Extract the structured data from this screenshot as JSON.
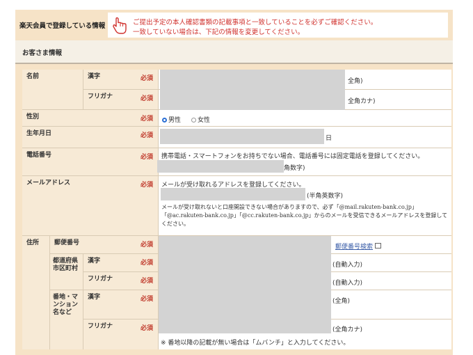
{
  "header": {
    "title": "楽天会員で登録している情報",
    "notice_line1": "ご提出予定の本人確認書類の記載事項と一致していることを必ずご確認ください。",
    "notice_line2": "一致していない場合は、下記の情報を変更してください。"
  },
  "section_title": "お客さま情報",
  "required_label": "必須",
  "fields": {
    "name": {
      "label": "名前",
      "kanji": "漢字",
      "furigana": "フリガナ",
      "kanji_hint": "全角)",
      "furigana_hint": "全角カナ)"
    },
    "gender": {
      "label": "性別",
      "options": [
        "男性",
        "女性"
      ],
      "selected": "男性"
    },
    "birthdate": {
      "label": "生年月日",
      "suffix": "日"
    },
    "phone": {
      "label": "電話番号",
      "note": "携帯電話・スマートフォンをお持ちでない場合、電話番号には固定電話を登録してください。",
      "hint": "角数字)"
    },
    "email": {
      "label": "メールアドレス",
      "note": "メールが受け取れるアドレスを登録してください。",
      "hint": "(半角英数字)",
      "warning1": "メールが受け取れないと口座開設できない場合がありますので、必ず「@mail.rakuten-bank.co.jp」",
      "warning2": "「@ac.rakuten-bank.co.jp」「@cc.rakuten-bank.co.jp」からのメールを受信できるメールアドレスを登録して",
      "warning3": "ください。"
    },
    "address": {
      "label": "住所",
      "postal_label": "郵便番号",
      "postal_link": "郵便番号検索",
      "pref_label": "都道府県市区町村",
      "street_label": "番地・マンション名など",
      "kanji": "漢字",
      "furigana": "フリガナ",
      "auto_input": "(自動入力)",
      "zenkaku": "(全角)",
      "zenkaku_kana": "(全角カナ)",
      "footnote": "※ 番地以降の記載が無い場合は「ムバンチ」と入力してください。"
    }
  },
  "colors": {
    "required": "#c0392b",
    "notice": "#d0312d",
    "link": "#3b5ea8",
    "label_bg": "#f7ead6",
    "frame_bg": "#f6e3c7"
  },
  "icons": {
    "notice": "pointing-hand-icon",
    "external": "external-window-icon"
  }
}
